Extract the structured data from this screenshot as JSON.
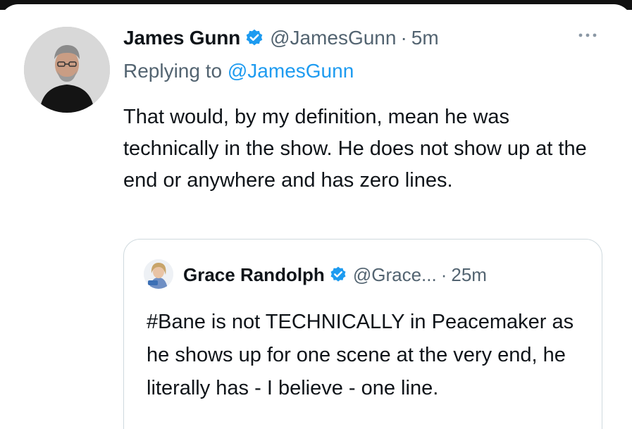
{
  "tweet": {
    "author_name": "James Gunn",
    "handle": "@JamesGunn",
    "separator": "·",
    "time": "5m",
    "replying_prefix": "Replying to ",
    "replying_to": "@JamesGunn",
    "text": "That would, by my definition, mean he was technically in the show. He does not show up at the end or anywhere and has zero lines.",
    "more_icon": "more-horizontal-icon",
    "verified_icon": "verified-badge-icon"
  },
  "quoted_tweet": {
    "author_name": "Grace Randolph",
    "handle": "@Grace...",
    "separator": "·",
    "time": "25m",
    "text": "#Bane is not TECHNICALLY in Peacemaker as he shows up for one scene at the very end, he literally has - I believe - one line.",
    "verified_icon": "verified-badge-icon"
  },
  "colors": {
    "verified": "#1d9bf0",
    "mention": "#1d9bf0",
    "secondary_text": "#536471",
    "border": "#cfd9de"
  }
}
